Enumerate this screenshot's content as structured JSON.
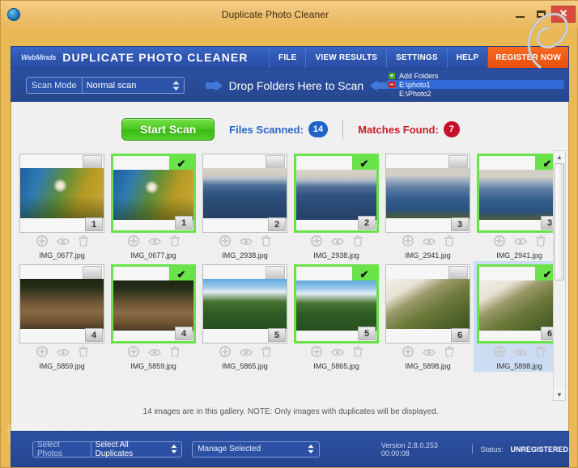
{
  "window": {
    "title": "Duplicate Photo Cleaner",
    "app_icon": "app-globe-icon",
    "minimize": "–",
    "maximize": "□",
    "close": "✕"
  },
  "header": {
    "brand_prefix": "WebMinds",
    "brand_title": "DUPLICATE PHOTO CLEANER",
    "nav": [
      {
        "label": "FILE",
        "style": "normal"
      },
      {
        "label": "VIEW RESULTS",
        "style": "normal"
      },
      {
        "label": "SETTINGS",
        "style": "normal"
      },
      {
        "label": "HELP",
        "style": "normal"
      },
      {
        "label": "REGISTER NOW",
        "style": "register"
      }
    ]
  },
  "scanbar": {
    "scan_mode_label": "Scan Mode",
    "scan_mode_value": "Normal scan",
    "drop_text": "Drop Folders Here to Scan",
    "folders": [
      {
        "badge": "+",
        "badge_kind": "add",
        "label": "Add Folders",
        "selected": false
      },
      {
        "badge": "−",
        "badge_kind": "rem",
        "label": "E:\\photo1",
        "selected": true
      },
      {
        "badge": "",
        "badge_kind": "none",
        "label": "E:\\Photo2",
        "selected": false
      }
    ]
  },
  "status": {
    "start_scan": "Start Scan",
    "files_scanned_label": "Files Scanned:",
    "files_scanned_value": "14",
    "matches_found_label": "Matches Found:",
    "matches_found_value": "7"
  },
  "gallery": {
    "note": "14 images are in this gallery. NOTE: Only images with duplicates will be displayed.",
    "icons": [
      "plus-circle-icon",
      "eye-icon",
      "trash-icon"
    ],
    "scroll_up": "▲",
    "scroll_down": "▼",
    "rows": [
      [
        {
          "name": "IMG_0677.jpg",
          "number": "1",
          "checked": false,
          "img": "dandelion",
          "row_selected": false
        },
        {
          "name": "IMG_0677.jpg",
          "number": "1",
          "checked": true,
          "img": "dandelion",
          "row_selected": false
        },
        {
          "name": "IMG_2938.jpg",
          "number": "2",
          "checked": false,
          "img": "bluemountains",
          "row_selected": false
        },
        {
          "name": "IMG_2938.jpg",
          "number": "2",
          "checked": true,
          "img": "bluemountains",
          "row_selected": false
        },
        {
          "name": "IMG_2941.jpg",
          "number": "3",
          "checked": false,
          "img": "bluemountains2",
          "row_selected": false
        },
        {
          "name": "IMG_2941.jpg",
          "number": "3",
          "checked": true,
          "img": "bluemountains2",
          "row_selected": false
        }
      ],
      [
        {
          "name": "IMG_5859.jpg",
          "number": "4",
          "checked": false,
          "img": "forest",
          "row_selected": false
        },
        {
          "name": "IMG_5859.jpg",
          "number": "4",
          "checked": true,
          "img": "forest",
          "row_selected": false
        },
        {
          "name": "IMG_5865.jpg",
          "number": "5",
          "checked": false,
          "img": "greenhill",
          "row_selected": false
        },
        {
          "name": "IMG_5865.jpg",
          "number": "5",
          "checked": true,
          "img": "greenhill",
          "row_selected": false
        },
        {
          "name": "IMG_5898.jpg",
          "number": "6",
          "checked": false,
          "img": "grasshill",
          "row_selected": false
        },
        {
          "name": "IMG_5898.jpg",
          "number": "6",
          "checked": true,
          "img": "grasshill",
          "row_selected": true
        }
      ]
    ]
  },
  "footer": {
    "select_photos_label": "Select Photos",
    "select_photos_value": "Select All Duplicates",
    "manage_selected_value": "Manage Selected",
    "version": "Version 2.8.0.253 00:00:08",
    "status_label": "Status:",
    "status_value": "UNREGISTERED"
  },
  "watermark": {
    "text": "filehorse",
    "suffix": ".com"
  },
  "colors": {
    "window_frame": "#e9b955",
    "nav_blue": "#2f57b2",
    "register_orange": "#f0560f",
    "start_green": "#4cc81e",
    "check_green": "#6ae24a",
    "files_blue": "#1f63c9",
    "matches_red": "#c9102a"
  }
}
